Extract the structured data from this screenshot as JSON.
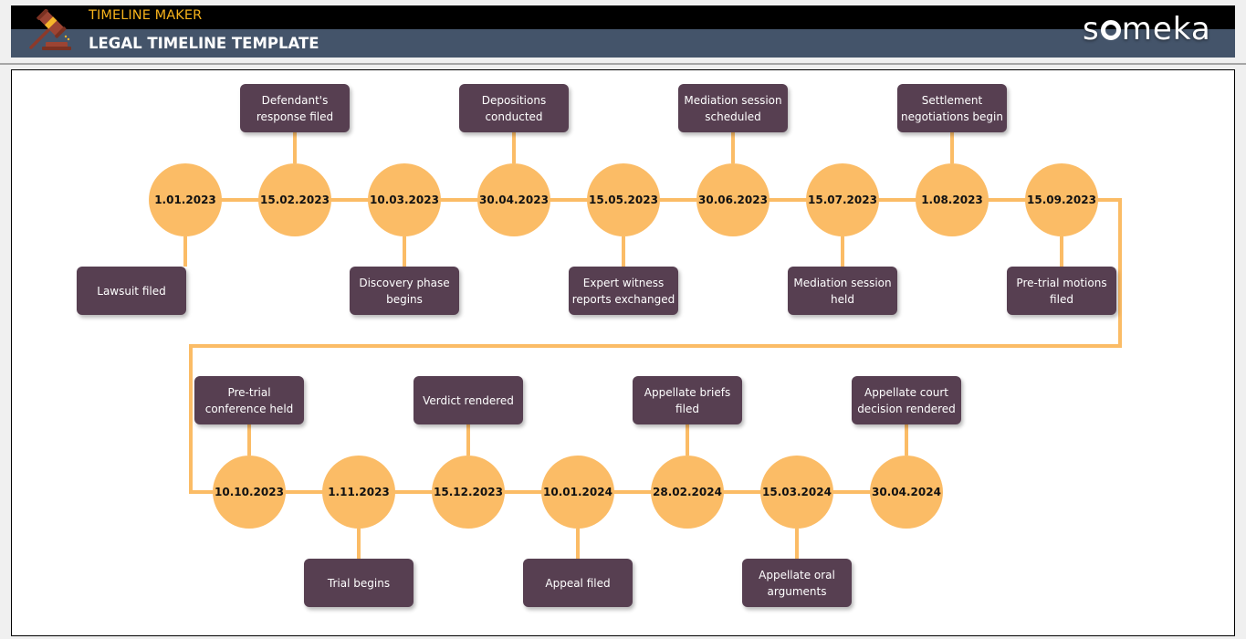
{
  "header": {
    "app_name": "TIMELINE MAKER",
    "page_title": "LEGAL TIMELINE TEMPLATE",
    "logo_text_before": "s",
    "logo_text_after": "meka",
    "icon": "gavel-icon"
  },
  "colors": {
    "accent_orange": "#fbbc66",
    "event_box": "#573f51",
    "header_black": "#000000",
    "header_slate": "#44546a",
    "app_name": "#f6b21b"
  },
  "timeline": {
    "rows": [
      {
        "events": [
          {
            "date": "1.01.2023",
            "label": "Lawsuit filed",
            "position": "below"
          },
          {
            "date": "15.02.2023",
            "label": "Defendant's response filed",
            "position": "above"
          },
          {
            "date": "10.03.2023",
            "label": "Discovery phase begins",
            "position": "below"
          },
          {
            "date": "30.04.2023",
            "label": "Depositions conducted",
            "position": "above"
          },
          {
            "date": "15.05.2023",
            "label": "Expert witness reports exchanged",
            "position": "below"
          },
          {
            "date": "30.06.2023",
            "label": "Mediation session scheduled",
            "position": "above"
          },
          {
            "date": "15.07.2023",
            "label": "Mediation session held",
            "position": "below"
          },
          {
            "date": "1.08.2023",
            "label": "Settlement negotiations begin",
            "position": "above"
          },
          {
            "date": "15.09.2023",
            "label": "Pre-trial motions filed",
            "position": "below"
          }
        ]
      },
      {
        "events": [
          {
            "date": "10.10.2023",
            "label": "Pre-trial conference held",
            "position": "above"
          },
          {
            "date": "1.11.2023",
            "label": "Trial begins",
            "position": "below"
          },
          {
            "date": "15.12.2023",
            "label": "Verdict rendered",
            "position": "above"
          },
          {
            "date": "10.01.2024",
            "label": "Appeal filed",
            "position": "below"
          },
          {
            "date": "28.02.2024",
            "label": "Appellate briefs filed",
            "position": "above"
          },
          {
            "date": "15.03.2024",
            "label": "Appellate oral arguments",
            "position": "below"
          },
          {
            "date": "30.04.2024",
            "label": "Appellate court decision rendered",
            "position": "above"
          }
        ]
      }
    ]
  }
}
